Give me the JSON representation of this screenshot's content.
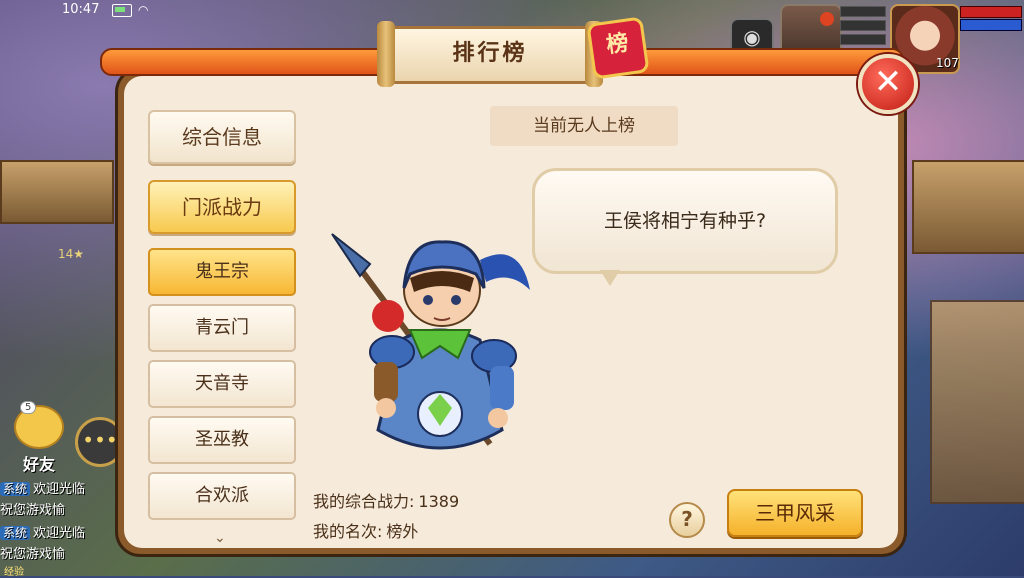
{
  "status_bar": {
    "time": "10:47"
  },
  "hud": {
    "friend_label": "好友",
    "friend_badge": "5",
    "level_text": "14",
    "chat_lines": [
      {
        "tag": "系统",
        "text": "欢迎光临"
      },
      {
        "tag": "",
        "text": "祝您游戏愉"
      },
      {
        "tag": "系统",
        "text": "欢迎光临"
      },
      {
        "tag": "",
        "text": "祝您游戏愉"
      }
    ],
    "exp_label": "经验",
    "player_level": "107"
  },
  "panel": {
    "title": "排行榜",
    "seal_text": "榜",
    "close_icon": "close-icon",
    "tabs": [
      {
        "label": "综合信息",
        "active": false
      },
      {
        "label": "门派战力",
        "active": true
      }
    ],
    "factions": [
      {
        "label": "鬼王宗",
        "active": true
      },
      {
        "label": "青云门",
        "active": false
      },
      {
        "label": "天音寺",
        "active": false
      },
      {
        "label": "圣巫教",
        "active": false
      },
      {
        "label": "合欢派",
        "active": false
      }
    ],
    "status": "当前无人上榜",
    "quote": "王侯将相宁有种乎?",
    "my_power_label": "我的综合战力:",
    "my_power_value": "1389",
    "my_rank_label": "我的名次:",
    "my_rank_value": "榜外",
    "help_label": "?",
    "action_label": "三甲风采"
  },
  "colors": {
    "panel_bg": "#f6eadb",
    "active_tab": "#f7c94e",
    "close_red": "#c11d14",
    "ribbon_orange": "#e0541a"
  }
}
